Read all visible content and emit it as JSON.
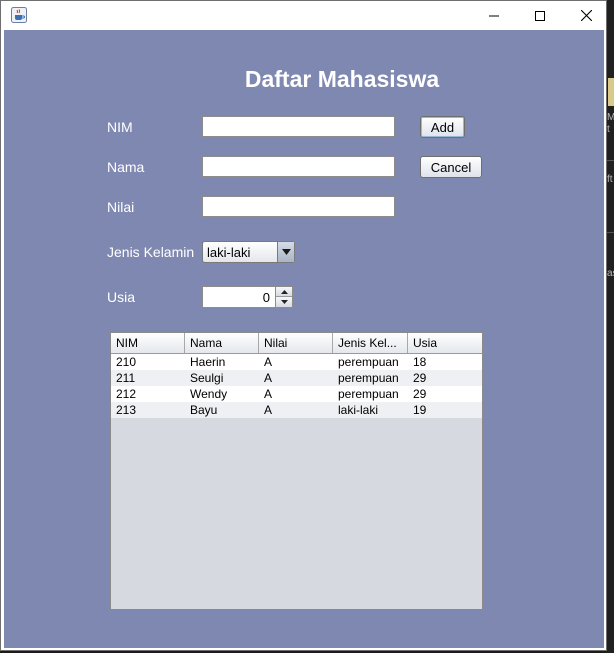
{
  "window": {
    "app_icon": "java-cup-icon",
    "controls": {
      "minimize": "minimize-icon",
      "maximize": "maximize-icon",
      "close": "close-icon"
    }
  },
  "form": {
    "title": "Daftar Mahasiswa",
    "nim_label": "NIM",
    "nim_value": "",
    "nama_label": "Nama",
    "nama_value": "",
    "nilai_label": "Nilai",
    "nilai_value": "",
    "gender_label": "Jenis Kelamin",
    "gender_selected": "laki-laki",
    "usia_label": "Usia",
    "usia_value": "0",
    "add_button": "Add",
    "cancel_button": "Cancel"
  },
  "table": {
    "columns": [
      "NIM",
      "Nama",
      "Nilai",
      "Jenis Kel...",
      "Usia"
    ],
    "rows": [
      [
        "210",
        "Haerin",
        "A",
        "perempuan",
        "18"
      ],
      [
        "211",
        "Seulgi",
        "A",
        "perempuan",
        "29"
      ],
      [
        "212",
        "Wendy",
        "A",
        "perempuan",
        "29"
      ],
      [
        "213",
        "Bayu",
        "A",
        "laki-laki",
        "19"
      ]
    ]
  },
  "background_fragments": [
    "M",
    "t",
    "ft",
    "as",
    "t"
  ],
  "colors": {
    "panel_bg": "#7f88b1",
    "table_bg": "#d6d9df"
  }
}
